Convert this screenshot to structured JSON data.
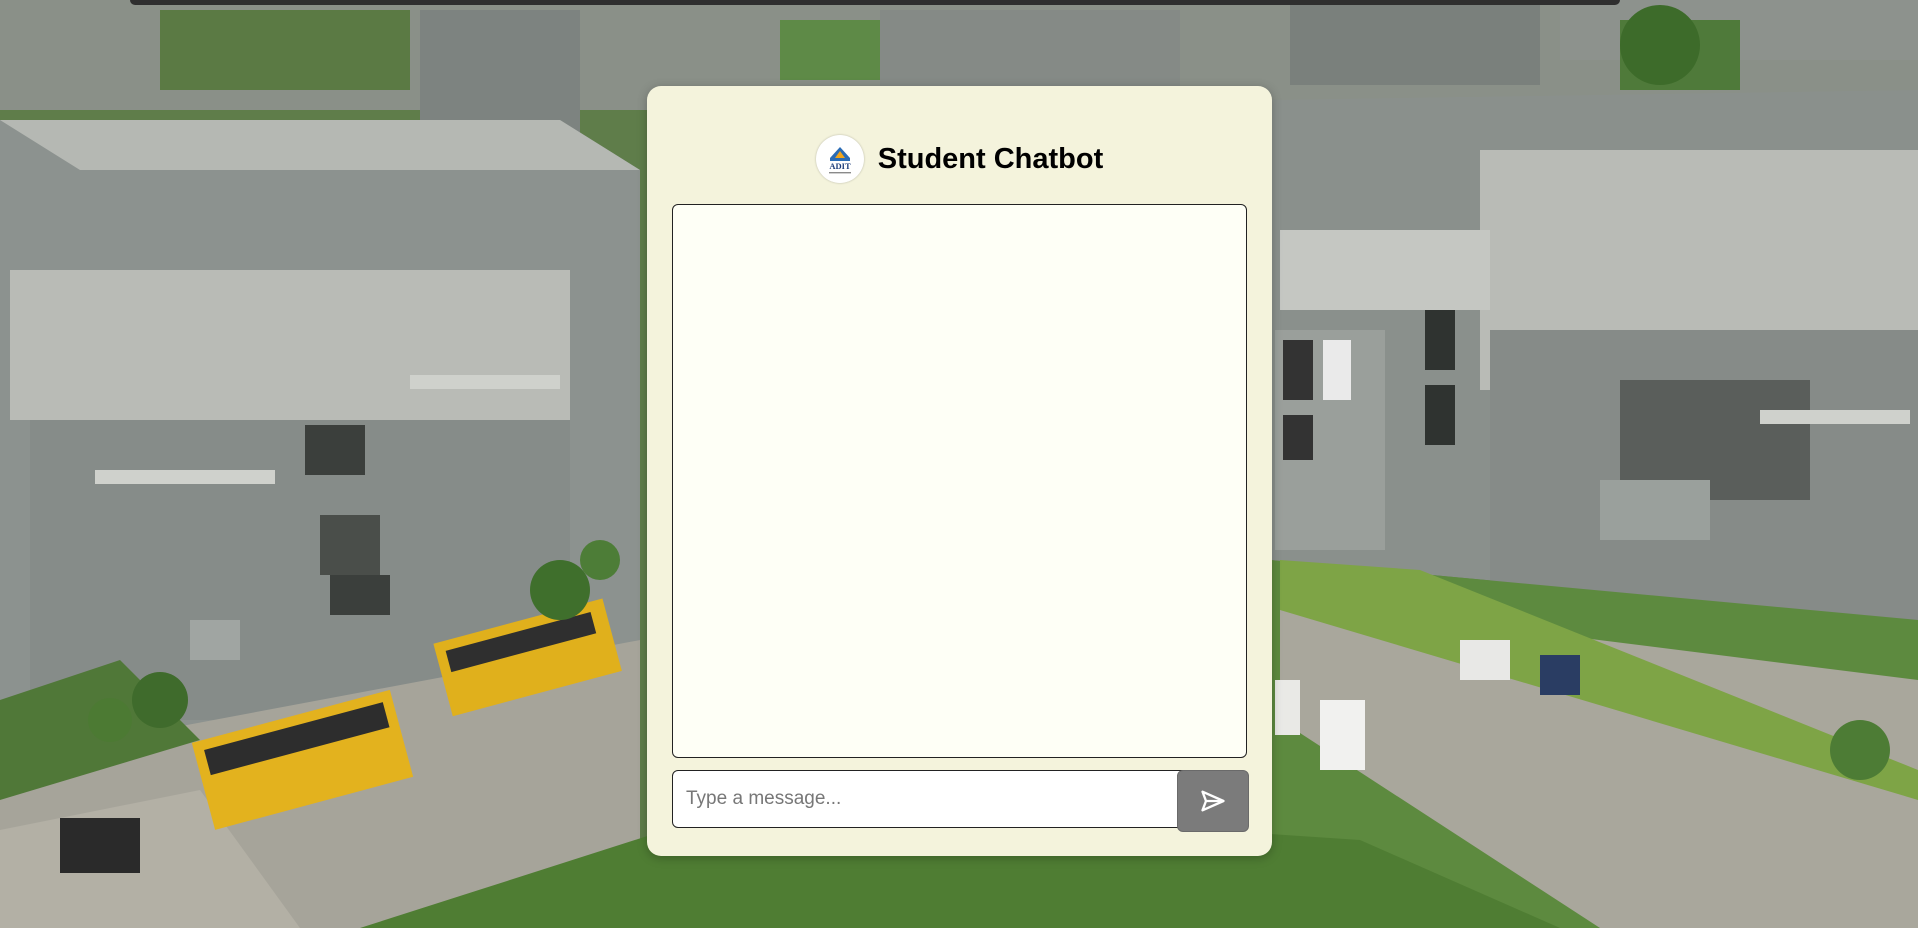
{
  "header": {
    "title": "Student Chatbot",
    "logo_text": "ADIT"
  },
  "chat": {
    "messages": []
  },
  "composer": {
    "input_value": "",
    "input_placeholder": "Type a message...",
    "send_icon": "send-icon"
  },
  "colors": {
    "panel_background": "#f4f3dc",
    "chat_background": "#fefff6",
    "send_button": "#7b7b7b"
  }
}
